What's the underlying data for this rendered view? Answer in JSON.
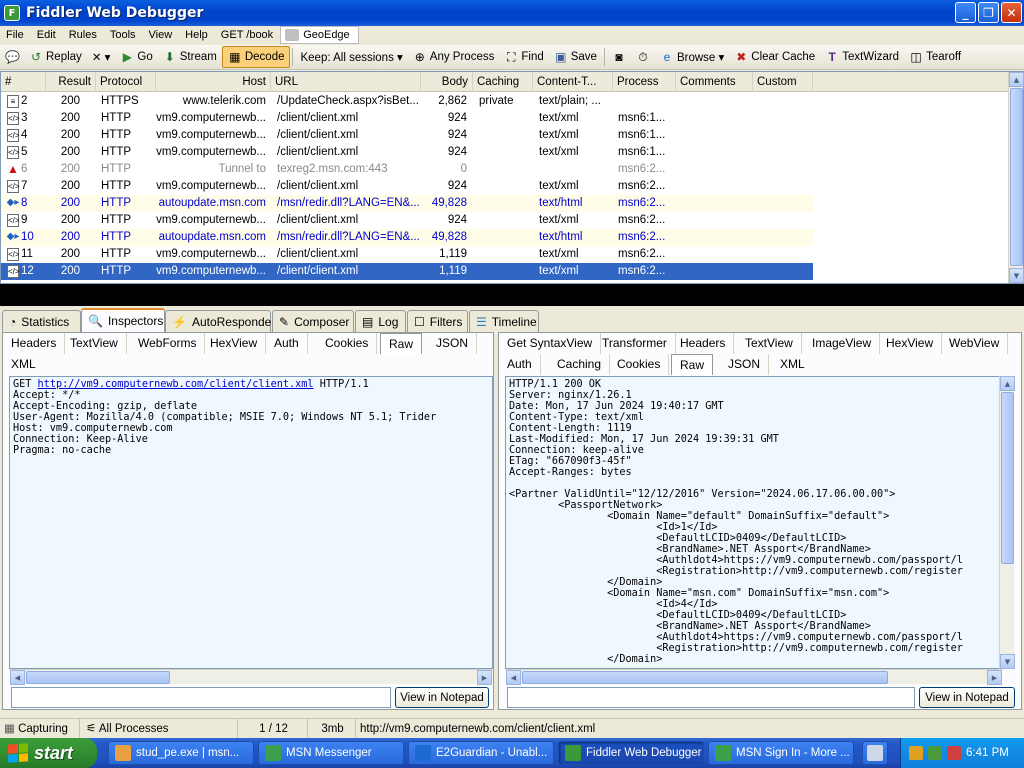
{
  "window": {
    "title": "Fiddler Web Debugger"
  },
  "menu": [
    "File",
    "Edit",
    "Rules",
    "Tools",
    "View",
    "Help",
    "GET /book",
    "GeoEdge"
  ],
  "toolbar": {
    "replay": "Replay",
    "remove": "✕ ▾",
    "go": "Go",
    "stream": "Stream",
    "decode": "Decode",
    "keep": "Keep: All sessions ▾",
    "any_process": "Any Process",
    "find": "Find",
    "save": "Save",
    "browse": "Browse ▾",
    "clear_cache": "Clear Cache",
    "textwizard": "TextWizard",
    "tearoff": "Tearoff"
  },
  "session_columns": [
    "#",
    "Result",
    "Protocol",
    "Host",
    "URL",
    "Body",
    "Caching",
    "Content-T...",
    "Process",
    "Comments",
    "Custom"
  ],
  "sessions": [
    {
      "id": "2",
      "result": "200",
      "protocol": "HTTPS",
      "host": "www.telerik.com",
      "url": "/UpdateCheck.aspx?isBet...",
      "body": "2,862",
      "caching": "private",
      "ctype": "text/plain; ...",
      "process": "",
      "style": "normal",
      "icon": "doc"
    },
    {
      "id": "3",
      "result": "200",
      "protocol": "HTTP",
      "host": "vm9.computernewb...",
      "url": "/client/client.xml",
      "body": "924",
      "caching": "",
      "ctype": "text/xml",
      "process": "msn6:1...",
      "style": "normal",
      "icon": "xml"
    },
    {
      "id": "4",
      "result": "200",
      "protocol": "HTTP",
      "host": "vm9.computernewb...",
      "url": "/client/client.xml",
      "body": "924",
      "caching": "",
      "ctype": "text/xml",
      "process": "msn6:1...",
      "style": "normal",
      "icon": "xml"
    },
    {
      "id": "5",
      "result": "200",
      "protocol": "HTTP",
      "host": "vm9.computernewb...",
      "url": "/client/client.xml",
      "body": "924",
      "caching": "",
      "ctype": "text/xml",
      "process": "msn6:1...",
      "style": "normal",
      "icon": "xml"
    },
    {
      "id": "6",
      "result": "200",
      "protocol": "HTTP",
      "host": "Tunnel to",
      "url": "texreg2.msn.com:443",
      "body": "0",
      "caching": "",
      "ctype": "",
      "process": "msn6:2...",
      "style": "gray",
      "icon": "warn"
    },
    {
      "id": "7",
      "result": "200",
      "protocol": "HTTP",
      "host": "vm9.computernewb...",
      "url": "/client/client.xml",
      "body": "924",
      "caching": "",
      "ctype": "text/xml",
      "process": "msn6:2...",
      "style": "normal",
      "icon": "xml"
    },
    {
      "id": "8",
      "result": "200",
      "protocol": "HTTP",
      "host": "autoupdate.msn.com",
      "url": "/msn/redir.dll?LANG=EN&...",
      "body": "49,828",
      "caching": "",
      "ctype": "text/html",
      "process": "msn6:2...",
      "style": "blue",
      "icon": "arrows"
    },
    {
      "id": "9",
      "result": "200",
      "protocol": "HTTP",
      "host": "vm9.computernewb...",
      "url": "/client/client.xml",
      "body": "924",
      "caching": "",
      "ctype": "text/xml",
      "process": "msn6:2...",
      "style": "normal",
      "icon": "xml"
    },
    {
      "id": "10",
      "result": "200",
      "protocol": "HTTP",
      "host": "autoupdate.msn.com",
      "url": "/msn/redir.dll?LANG=EN&...",
      "body": "49,828",
      "caching": "",
      "ctype": "text/html",
      "process": "msn6:2...",
      "style": "blue",
      "icon": "arrows"
    },
    {
      "id": "11",
      "result": "200",
      "protocol": "HTTP",
      "host": "vm9.computernewb...",
      "url": "/client/client.xml",
      "body": "1,119",
      "caching": "",
      "ctype": "text/xml",
      "process": "msn6:2...",
      "style": "normal",
      "icon": "xml"
    },
    {
      "id": "12",
      "result": "200",
      "protocol": "HTTP",
      "host": "vm9.computernewb...",
      "url": "/client/client.xml",
      "body": "1,119",
      "caching": "",
      "ctype": "text/xml",
      "process": "msn6:2...",
      "style": "selected",
      "icon": "xml"
    }
  ],
  "main_tabs": [
    "Statistics",
    "Inspectors",
    "AutoResponder",
    "Composer",
    "Log",
    "Filters",
    "Timeline"
  ],
  "request": {
    "tabs_row1": [
      "Headers",
      "TextView",
      "WebForms",
      "HexView",
      "Auth",
      "Cookies",
      "Raw",
      "JSON"
    ],
    "tabs_row2": [
      "XML"
    ],
    "active_tab": "Raw",
    "method": "GET ",
    "url": "http://vm9.computernewb.com/client/client.xml",
    "version": " HTTP/1.1",
    "lines": "Accept: */*\nAccept-Encoding: gzip, deflate\nUser-Agent: Mozilla/4.0 (compatible; MSIE 7.0; Windows NT 5.1; Trider\nHost: vm9.computernewb.com\nConnection: Keep-Alive\nPragma: no-cache",
    "notepad_button": "View in Notepad"
  },
  "response": {
    "tabs_row1": [
      "Get SyntaxView",
      "Transformer",
      "Headers",
      "TextView",
      "ImageView",
      "HexView",
      "WebView"
    ],
    "tabs_row2": [
      "Auth",
      "Caching",
      "Cookies",
      "Raw",
      "JSON",
      "XML"
    ],
    "active_tab": "Raw",
    "body": "HTTP/1.1 200 OK\nServer: nginx/1.26.1\nDate: Mon, 17 Jun 2024 19:40:17 GMT\nContent-Type: text/xml\nContent-Length: 1119\nLast-Modified: Mon, 17 Jun 2024 19:39:31 GMT\nConnection: keep-alive\nETag: \"667090f3-45f\"\nAccept-Ranges: bytes\n\n<Partner ValidUntil=\"12/12/2016\" Version=\"2024.06.17.06.00.00\">\n        <PassportNetwork>\n                <Domain Name=\"default\" DomainSuffix=\"default\">\n                        <Id>1</Id>\n                        <DefaultLCID>0409</DefaultLCID>\n                        <BrandName>.NET Assport</BrandName>\n                        <Authldot4>https://vm9.computernewb.com/passport/l\n                        <Registration>http://vm9.computernewb.com/register\n                </Domain>\n                <Domain Name=\"msn.com\" DomainSuffix=\"msn.com\">\n                        <Id>4</Id>\n                        <DefaultLCID>0409</DefaultLCID>\n                        <BrandName>.NET Assport</BrandName>\n                        <Authldot4>https://vm9.computernewb.com/passport/l\n                        <Registration>http://vm9.computernewb.com/register\n                </Domain>",
    "notepad_button": "View in Notepad"
  },
  "status": {
    "capturing": "Capturing",
    "processes": "All Processes",
    "count": "1 / 12",
    "memory": "3mb",
    "url": "http://vm9.computernewb.com/client/client.xml"
  },
  "taskbar": {
    "start": "start",
    "tasks": [
      "stud_pe.exe | msn...",
      "MSN Messenger",
      "E2Guardian - Unabl...",
      "Fiddler Web Debugger",
      "MSN Sign In - More ..."
    ],
    "clock": "6:41 PM"
  }
}
